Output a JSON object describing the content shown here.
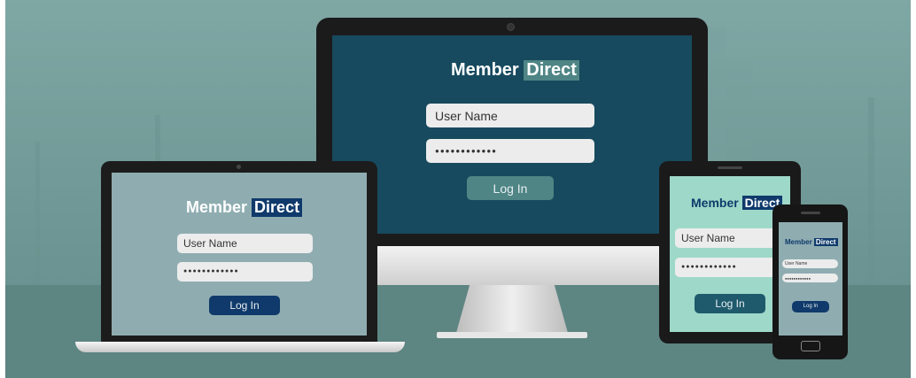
{
  "brand": {
    "word1": "Member",
    "word2": "Direct"
  },
  "login": {
    "username_placeholder": "User Name",
    "password_value": "●●●●●●●●●●●●",
    "login_label": "Log In"
  },
  "colors": {
    "imac_screen": "#174a5e",
    "laptop_screen": "#8fadb1",
    "tablet_screen": "#9ed8c8",
    "phone_screen": "#8fadb1",
    "dark_button": "#0f3a6b",
    "muted_button": "#4f8585"
  }
}
